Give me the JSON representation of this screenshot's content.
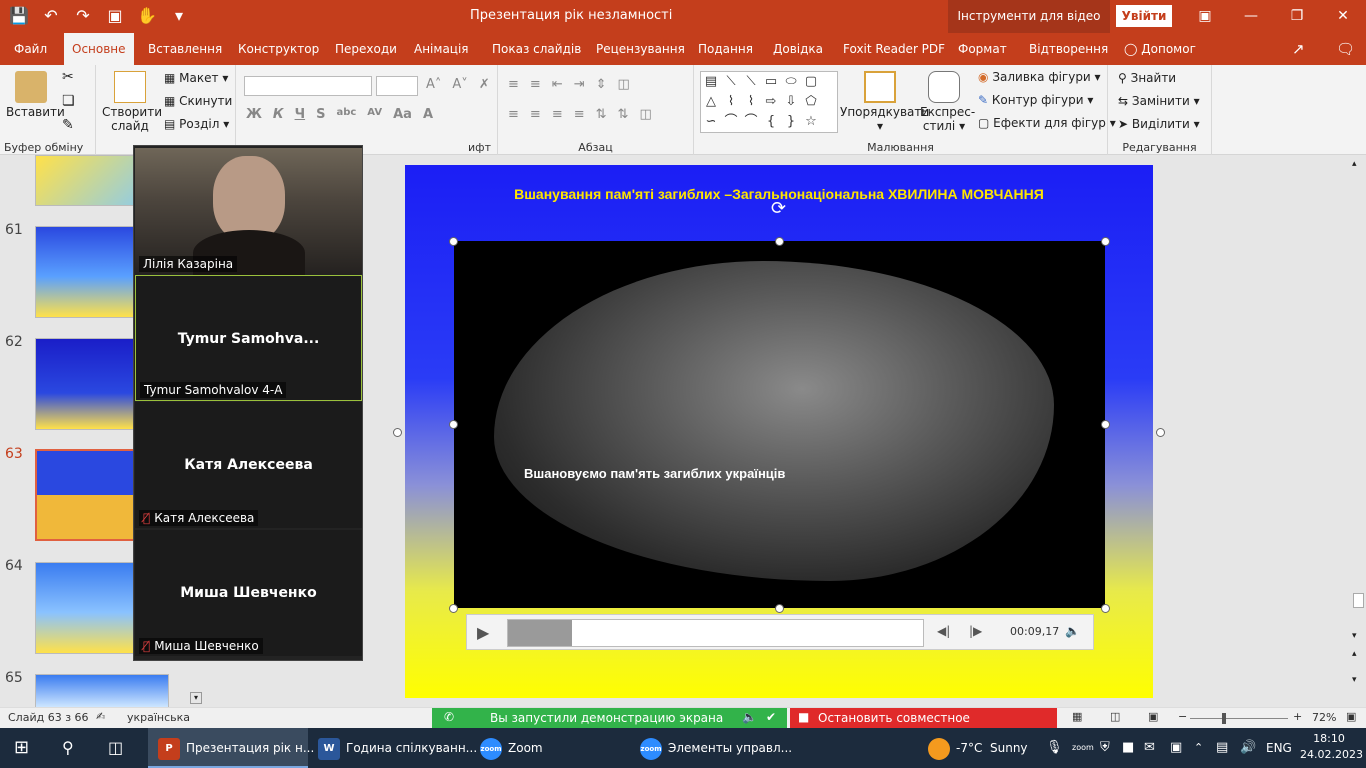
{
  "window": {
    "title": "Презентация рік незламності",
    "tools_tab": "Інструменти для відео",
    "login": "Увійти"
  },
  "tabs": [
    "Файл",
    "Основне",
    "Вставлення",
    "Конструктор",
    "Переходи",
    "Анімація",
    "Показ слайдів",
    "Рецензування",
    "Подання",
    "Довідка",
    "Foxit Reader PDF",
    "Формат",
    "Відтворення",
    "Допомог"
  ],
  "ribbon": {
    "clipboard": {
      "paste": "Вставити",
      "label": "Буфер обміну"
    },
    "slides": {
      "new_slide_1": "Створити",
      "new_slide_2": "слайд",
      "layout": "Макет",
      "reset": "Скинути",
      "section": "Розділ",
      "label_partial": "ифт"
    },
    "paragraph": {
      "label": "Абзац"
    },
    "drawing": {
      "arrange": "Упорядкувати",
      "quick_styles_1": "Експрес-",
      "quick_styles_2": "стилі",
      "fill": "Заливка фігури",
      "outline": "Контур фігури",
      "effects": "Ефекти для фігур",
      "label": "Малювання"
    },
    "editing": {
      "find": "Знайти",
      "replace": "Замінити",
      "select": "Виділити",
      "label": "Редагування"
    }
  },
  "thumbnails": [
    {
      "num": "61"
    },
    {
      "num": "62"
    },
    {
      "num": "63",
      "selected": true
    },
    {
      "num": "64"
    },
    {
      "num": "65"
    }
  ],
  "zoom_participants": [
    {
      "name_label": "Лілія Казаріна",
      "center_name": "",
      "muted": false,
      "video": true
    },
    {
      "name_label": "Tymur Samohvalov 4-А",
      "center_name": "Tymur  Samohva...",
      "muted": false,
      "video": false
    },
    {
      "name_label": "Катя Алексеева",
      "center_name": "Катя Алексеева",
      "muted": true,
      "video": false
    },
    {
      "name_label": "Миша Шевченко",
      "center_name": "Миша Шевченко",
      "muted": true,
      "video": false
    }
  ],
  "slide": {
    "title": "Вшанування пам'яті загиблих –Загальнонаціональна ХВИЛИНА МОВЧАННЯ",
    "video_caption": "Вшановуємо пам'ять загиблих українців"
  },
  "player": {
    "time": "00:09,17",
    "progress": 0.155
  },
  "status": {
    "slide_count": "Слайд 63 з 66",
    "language": "українська",
    "share_notice": "Вы запустили демонстрацию экрана",
    "stop_share": "Остановить совместное использование",
    "zoom": "72%"
  },
  "taskbar": {
    "items": [
      "Презентация рік н...",
      "Година спілкуванн...",
      "Zoom",
      "Элементы управл..."
    ],
    "weather_temp": "-7°C",
    "weather_desc": "Sunny",
    "lang": "ENG",
    "time": "18:10",
    "date": "24.02.2023"
  },
  "colors": {
    "accent": "#c43e1c",
    "zoom_highlight": "#9bc13c",
    "share_green": "#32b34a",
    "share_red": "#e02a2a"
  }
}
